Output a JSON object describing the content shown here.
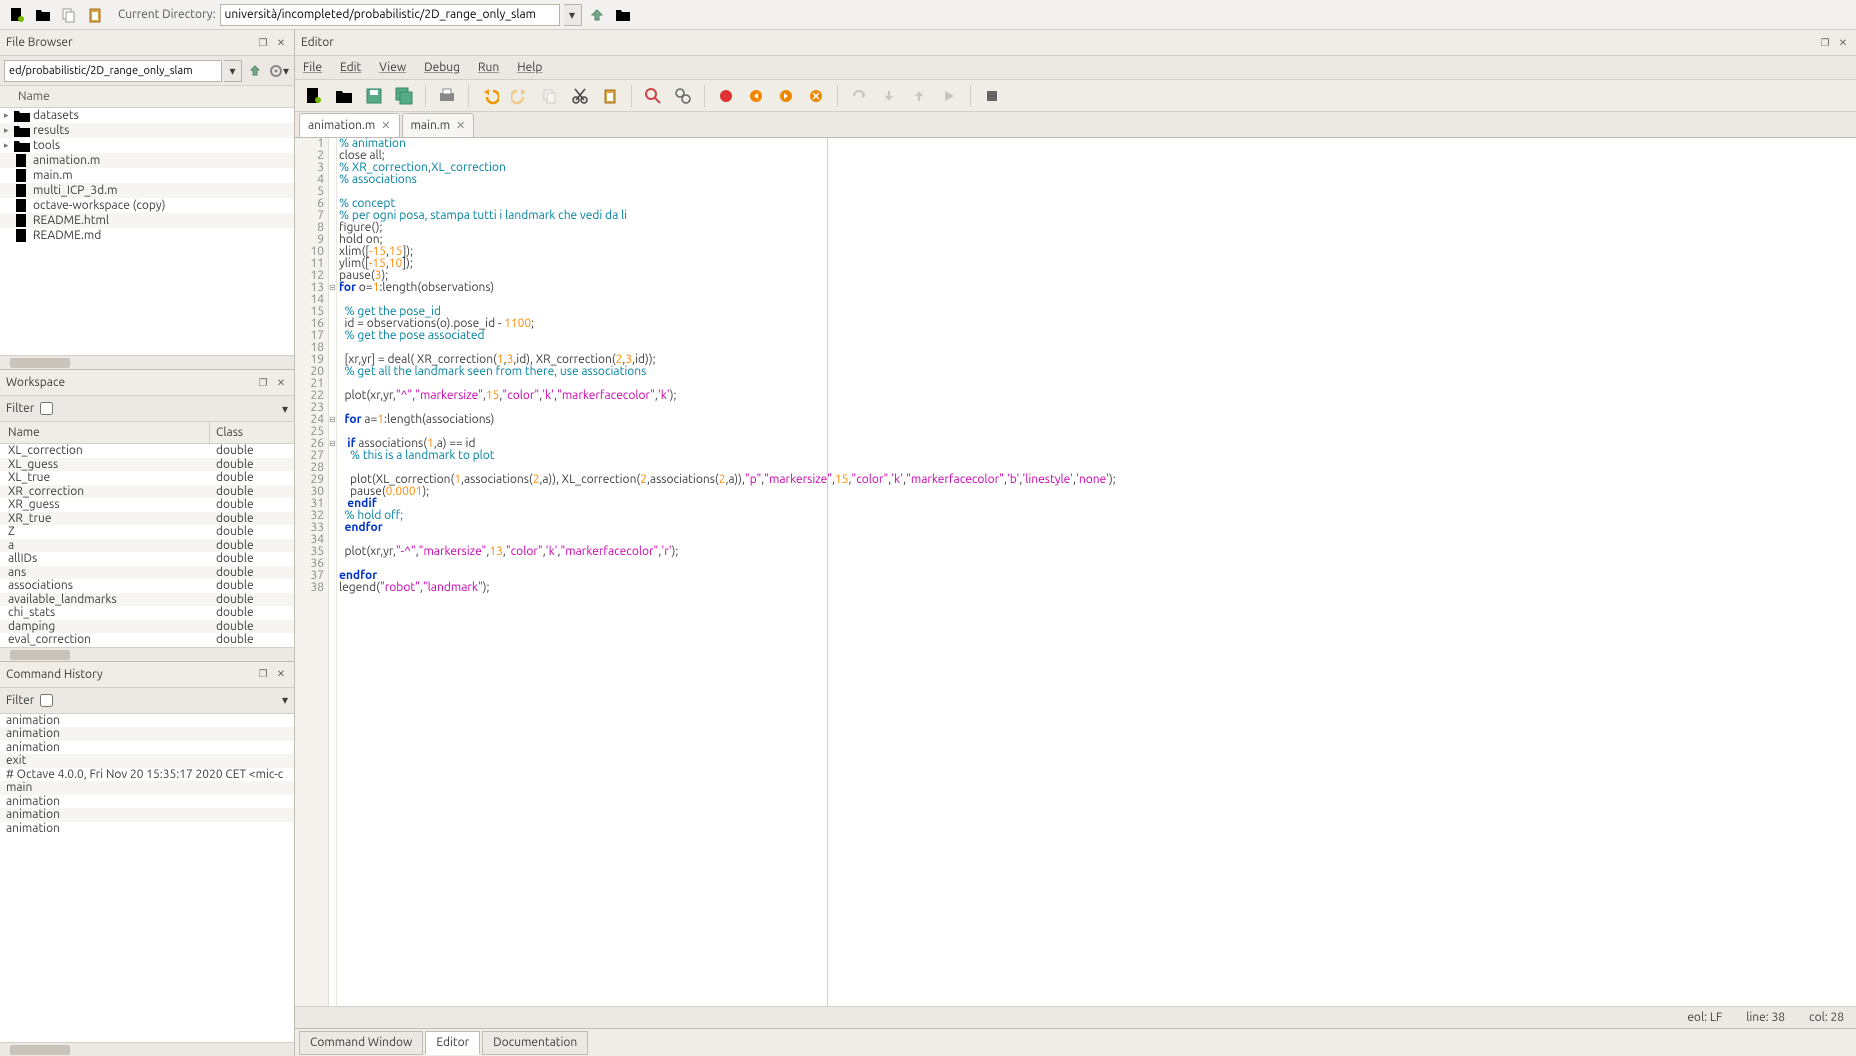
{
  "toolbar": {
    "dir_label": "Current Directory:",
    "dir_value": "università/incompleted/probabilistic/2D_range_only_slam"
  },
  "fileBrowser": {
    "title": "File Browser",
    "path": "ed/probabilistic/2D_range_only_slam",
    "header": "Name",
    "items": [
      {
        "name": "datasets",
        "type": "folder",
        "expandable": true
      },
      {
        "name": "results",
        "type": "folder",
        "expandable": true
      },
      {
        "name": "tools",
        "type": "folder",
        "expandable": true
      },
      {
        "name": "animation.m",
        "type": "file"
      },
      {
        "name": "main.m",
        "type": "file"
      },
      {
        "name": "multi_ICP_3d.m",
        "type": "file"
      },
      {
        "name": "octave-workspace (copy)",
        "type": "file"
      },
      {
        "name": "README.html",
        "type": "file"
      },
      {
        "name": "README.md",
        "type": "file"
      }
    ]
  },
  "workspace": {
    "title": "Workspace",
    "filter_label": "Filter",
    "col_name": "Name",
    "col_class": "Class",
    "vars": [
      {
        "name": "XL_correction",
        "class": "double"
      },
      {
        "name": "XL_guess",
        "class": "double"
      },
      {
        "name": "XL_true",
        "class": "double"
      },
      {
        "name": "XR_correction",
        "class": "double"
      },
      {
        "name": "XR_guess",
        "class": "double"
      },
      {
        "name": "XR_true",
        "class": "double"
      },
      {
        "name": "Z",
        "class": "double"
      },
      {
        "name": "a",
        "class": "double"
      },
      {
        "name": "allIDs",
        "class": "double"
      },
      {
        "name": "ans",
        "class": "double"
      },
      {
        "name": "associations",
        "class": "double"
      },
      {
        "name": "available_landmarks",
        "class": "double"
      },
      {
        "name": "chi_stats",
        "class": "double"
      },
      {
        "name": "damping",
        "class": "double"
      },
      {
        "name": "eval_correction",
        "class": "double"
      }
    ]
  },
  "history": {
    "title": "Command History",
    "filter_label": "Filter",
    "items": [
      "animation",
      "animation",
      "animation",
      "exit",
      "# Octave 4.0.0, Fri Nov 20 15:35:17 2020 CET <mic-c",
      "main",
      "animation",
      "animation",
      "animation"
    ]
  },
  "editor": {
    "title": "Editor",
    "menu": [
      "File",
      "Edit",
      "View",
      "Debug",
      "Run",
      "Help"
    ],
    "tabs": [
      {
        "label": "animation.m",
        "active": true
      },
      {
        "label": "main.m",
        "active": false
      }
    ],
    "status": {
      "eol": "eol: LF",
      "line": "line: 38",
      "col": "col: 28"
    }
  },
  "bottomTabs": [
    "Command Window",
    "Editor",
    "Documentation"
  ],
  "code": [
    {
      "n": 1,
      "html": "<span class='c-comment'>% animation</span>"
    },
    {
      "n": 2,
      "html": "close all;"
    },
    {
      "n": 3,
      "html": "<span class='c-comment'>% XR_correction,XL_correction</span>"
    },
    {
      "n": 4,
      "html": "<span class='c-comment'>% associations</span>"
    },
    {
      "n": 5,
      "html": ""
    },
    {
      "n": 6,
      "html": "<span class='c-comment'>% concept</span>"
    },
    {
      "n": 7,
      "html": "<span class='c-comment'>% per ogni posa, stampa tutti i landmark che vedi da li</span>"
    },
    {
      "n": 8,
      "html": "figure();"
    },
    {
      "n": 9,
      "html": "hold on;"
    },
    {
      "n": 10,
      "html": "xlim([<span class='c-num'>-15</span>,<span class='c-num'>15</span>]);"
    },
    {
      "n": 11,
      "html": "ylim([<span class='c-num'>-15</span>,<span class='c-num'>10</span>]);"
    },
    {
      "n": 12,
      "html": "pause(<span class='c-num'>3</span>);"
    },
    {
      "n": 13,
      "fold": "⊟",
      "html": "<span class='c-kw'>for</span> o=<span class='c-num'>1</span>:length(observations)"
    },
    {
      "n": 14,
      "html": ""
    },
    {
      "n": 15,
      "html": "  <span class='c-comment'>% get the pose_id</span>"
    },
    {
      "n": 16,
      "html": "  id = observations(o).pose_id - <span class='c-num'>1100</span>;"
    },
    {
      "n": 17,
      "html": "  <span class='c-comment'>% get the pose associated</span>"
    },
    {
      "n": 18,
      "html": "  "
    },
    {
      "n": 19,
      "html": "  [xr,yr] = deal( XR_correction(<span class='c-num'>1</span>,<span class='c-num'>3</span>,id), XR_correction(<span class='c-num'>2</span>,<span class='c-num'>3</span>,id));"
    },
    {
      "n": 20,
      "html": "  <span class='c-comment'>% get all the landmark seen from there, use associations</span>"
    },
    {
      "n": 21,
      "html": ""
    },
    {
      "n": 22,
      "html": "  plot(xr,yr,<span class='c-str'>\"^\"</span>,<span class='c-str'>\"markersize\"</span>,<span class='c-num'>15</span>,<span class='c-str'>\"color\"</span>,<span class='c-str'>'k'</span>,<span class='c-str'>\"markerfacecolor\"</span>,<span class='c-str'>'k'</span>);"
    },
    {
      "n": 23,
      "html": ""
    },
    {
      "n": 24,
      "fold": "⊟",
      "html": "  <span class='c-kw'>for</span> a=<span class='c-num'>1</span>:length(associations)"
    },
    {
      "n": 25,
      "html": ""
    },
    {
      "n": 26,
      "fold": "⊟",
      "html": "   <span class='c-kw'>if</span> associations(<span class='c-num'>1</span>,a) == id"
    },
    {
      "n": 27,
      "html": "    <span class='c-comment'>% this is a landmark to plot</span>"
    },
    {
      "n": 28,
      "html": ""
    },
    {
      "n": 29,
      "html": "    plot(XL_correction(<span class='c-num'>1</span>,associations(<span class='c-num'>2</span>,a)), XL_correction(<span class='c-num'>2</span>,associations(<span class='c-num'>2</span>,a)),<span class='c-str'>\"p\"</span>,<span class='c-str'>\"markersize\"</span>,<span class='c-num'>15</span>,<span class='c-str'>\"color\"</span>,<span class='c-str'>'k'</span>,<span class='c-str'>\"markerfacecolor\"</span>,<span class='c-str'>'b'</span>,<span class='c-str'>'linestyle'</span>,<span class='c-str'>'none'</span>);"
    },
    {
      "n": 30,
      "html": "    pause(<span class='c-num'>0.0001</span>);"
    },
    {
      "n": 31,
      "html": "   <span class='c-kw'>endif</span>"
    },
    {
      "n": 32,
      "html": "  <span class='c-comment'>% hold off;</span>"
    },
    {
      "n": 33,
      "html": "  <span class='c-kw'>endfor</span>"
    },
    {
      "n": 34,
      "html": ""
    },
    {
      "n": 35,
      "html": "  plot(xr,yr,<span class='c-str'>\"-^\"</span>,<span class='c-str'>\"markersize\"</span>,<span class='c-num'>13</span>,<span class='c-str'>\"color\"</span>,<span class='c-str'>'k'</span>,<span class='c-str'>\"markerfacecolor\"</span>,<span class='c-str'>'r'</span>);"
    },
    {
      "n": 36,
      "html": ""
    },
    {
      "n": 37,
      "html": "<span class='c-kw'>endfor</span>"
    },
    {
      "n": 38,
      "html": "legend(<span class='c-str'>\"robot\"</span>,<span class='c-str'>\"landmark\"</span>);"
    }
  ]
}
